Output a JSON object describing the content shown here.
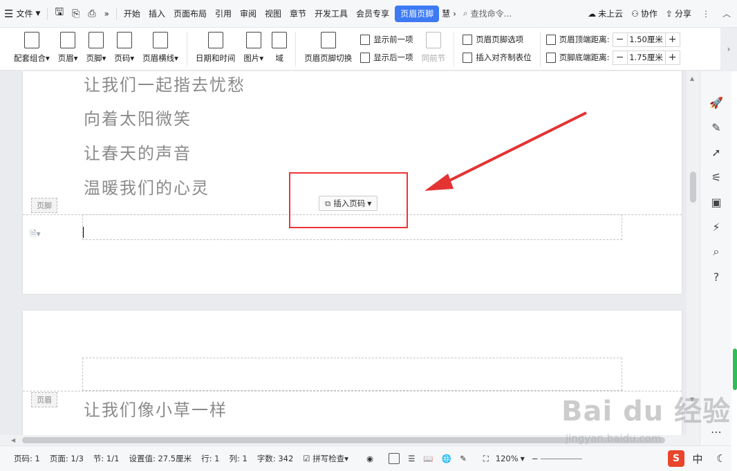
{
  "menubar": {
    "file_label": "文件",
    "tabs": [
      "开始",
      "插入",
      "页面布局",
      "引用",
      "审阅",
      "视图",
      "章节",
      "开发工具",
      "会员专享"
    ],
    "active_tab": "页眉页脚",
    "overflow_tab": "慧",
    "search_placeholder": "查找命令...",
    "cloud_label": "未上云",
    "collab_label": "协作",
    "share_label": "分享"
  },
  "ribbon": {
    "set_combo": "配套组合",
    "header": "页眉",
    "footer": "页脚",
    "page_number": "页码",
    "header_line": "页眉横线",
    "date_time": "日期和时间",
    "picture": "图片",
    "field": "域",
    "hf_switch": "页眉页脚切换",
    "show_prev": "显示前一项",
    "show_next": "显示后一项",
    "same_section": "同前节",
    "hf_options": "页眉页脚选项",
    "insert_align_tab": "插入对齐制表位",
    "header_top_label": "页眉顶端距离:",
    "header_top_value": "1.50厘米",
    "footer_bottom_label": "页脚底端距离:",
    "footer_bottom_value": "1.75厘米"
  },
  "page1": {
    "lines": [
      "让我们一起揩去忧愁",
      "向着太阳微笑",
      "让春天的声音",
      "温暖我们的心灵"
    ],
    "footer_tag": "页脚",
    "insert_page_number": "插入页码"
  },
  "page2": {
    "header_tag": "页眉",
    "line1": "让我们像小草一样"
  },
  "statusbar": {
    "page_num": "页码: 1",
    "pages": "页面: 1/3",
    "section": "节: 1/1",
    "setting": "设置值: 27.5厘米",
    "row": "行: 1",
    "col": "列: 1",
    "word_count": "字数: 342",
    "spell_check": "拼写检查",
    "zoom": "120%",
    "ime_lang": "中"
  },
  "watermark": {
    "main": "Bai du 经验",
    "sub": "jingyan.baidu.com"
  },
  "colors": {
    "accent": "#3d7af4",
    "highlight": "#e33333",
    "arrow": "#e33333"
  }
}
